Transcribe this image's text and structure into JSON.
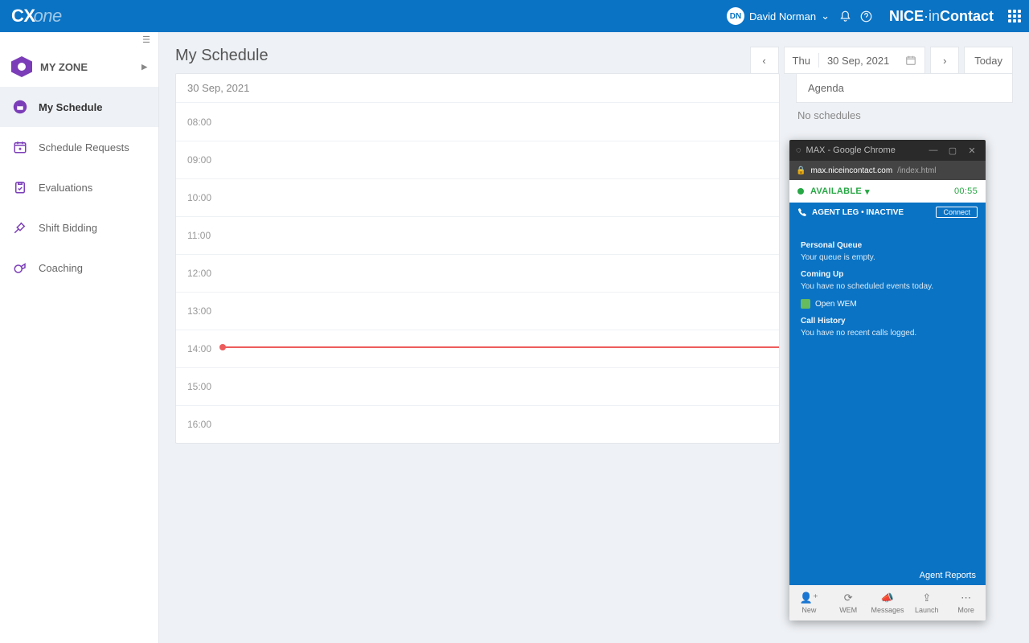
{
  "topbar": {
    "logo_cx": "CX",
    "logo_one": "one",
    "user_initials": "DN",
    "user_name": "David Norman",
    "brand_nice": "NICE",
    "brand_dot": "·",
    "brand_in": "in",
    "brand_contact": "Contact"
  },
  "sidebar": {
    "zone": "MY ZONE",
    "items": [
      "My Schedule",
      "Schedule Requests",
      "Evaluations",
      "Shift Bidding",
      "Coaching"
    ],
    "active_index": 0
  },
  "page": {
    "title": "My Schedule",
    "agenda_hdr": "Agenda",
    "agenda_empty": "No schedules"
  },
  "daypicker": {
    "dow": "Thu",
    "date": "30 Sep, 2021",
    "today": "Today"
  },
  "calendar": {
    "header": "30 Sep, 2021",
    "hours": [
      "08:00",
      "09:00",
      "10:00",
      "11:00",
      "12:00",
      "13:00",
      "14:00",
      "15:00",
      "16:00"
    ],
    "now_row_index": 6
  },
  "max": {
    "win_title": "MAX - Google Chrome",
    "url_domain": "max.niceincontact.com",
    "url_path": "/index.html",
    "status_label": "AVAILABLE",
    "status_time": "00:55",
    "agent_leg": "AGENT LEG • INACTIVE",
    "connect": "Connect",
    "sections": {
      "pq_h": "Personal Queue",
      "pq_t": "Your queue is empty.",
      "cu_h": "Coming Up",
      "cu_t": "You have no scheduled events today.",
      "open_wem": "Open WEM",
      "ch_h": "Call History",
      "ch_t": "You have no recent calls logged."
    },
    "reports": "Agent Reports",
    "bottom": [
      "New",
      "WEM",
      "Messages",
      "Launch",
      "More"
    ]
  }
}
